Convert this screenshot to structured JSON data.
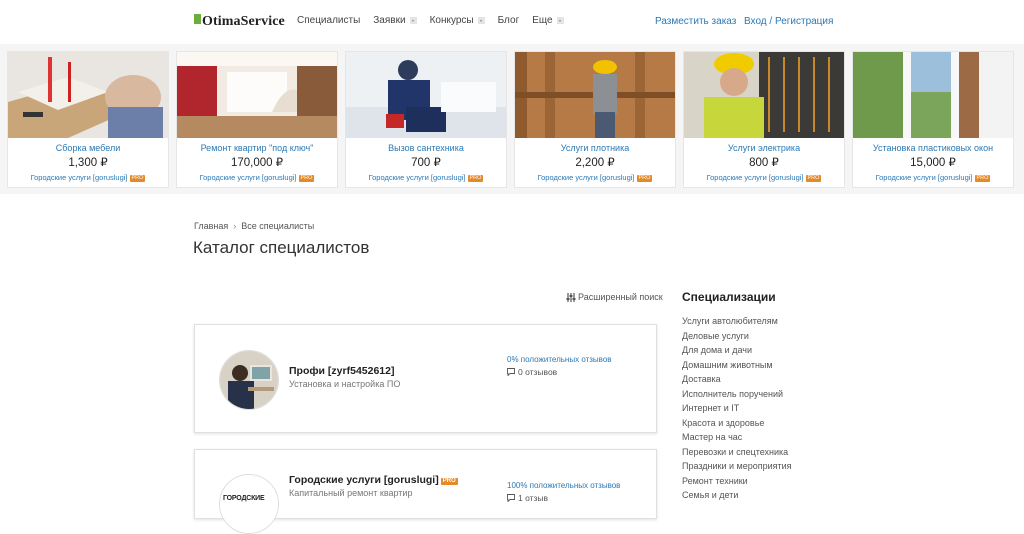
{
  "header": {
    "logo_text": "OtimaService",
    "nav": [
      {
        "label": "Специалисты",
        "dropdown": false
      },
      {
        "label": "Заявки",
        "dropdown": true
      },
      {
        "label": "Конкурсы",
        "dropdown": true
      },
      {
        "label": "Блог",
        "dropdown": false
      },
      {
        "label": "Еще",
        "dropdown": true
      }
    ],
    "post_order": "Разместить заказ",
    "login": "Вход / Регистрация"
  },
  "carousel": [
    {
      "title": "Сборка мебели",
      "price": "1,300 ₽",
      "provider": "Городские услуги [goruslugi]",
      "badge": "PRO"
    },
    {
      "title": "Ремонт квартир \"под ключ\"",
      "price": "170,000 ₽",
      "provider": "Городские услуги [goruslugi]",
      "badge": "PRO"
    },
    {
      "title": "Вызов сантехника",
      "price": "700 ₽",
      "provider": "Городские услуги [goruslugi]",
      "badge": "PRO"
    },
    {
      "title": "Услуги плотника",
      "price": "2,200 ₽",
      "provider": "Городские услуги [goruslugi]",
      "badge": "PRO"
    },
    {
      "title": "Услуги электрика",
      "price": "800 ₽",
      "provider": "Городские услуги [goruslugi]",
      "badge": "PRO"
    },
    {
      "title": "Установка пластиковых окон",
      "price": "15,000 ₽",
      "provider": "Городские услуги [goruslugi]",
      "badge": "PRO"
    }
  ],
  "breadcrumb": {
    "home": "Главная",
    "sep": "›",
    "current": "Все специалисты"
  },
  "page_title": "Каталог специалистов",
  "advanced_search": "Расширенный поиск",
  "specialists": [
    {
      "name": "Профи [zyrf5452612]",
      "subtitle": "Установка и настройка ПО",
      "rating": "0% положительных отзывов",
      "reviews": "0 отзывов",
      "badge": ""
    },
    {
      "name": "Городские услуги [goruslugi]",
      "subtitle": "Капитальный ремонт квартир",
      "rating": "100% положительных отзывов",
      "reviews": "1 отзыв",
      "badge": "PRO",
      "avatar_text": "ГОРОДСКИЕ"
    }
  ],
  "sidebar": {
    "title": "Специализации",
    "items": [
      "Услуги автолюбителям",
      "Деловые услуги",
      "Для дома и дачи",
      "Домашним животным",
      "Доставка",
      "Исполнитель поручений",
      "Интернет и IT",
      "Красота и здоровье",
      "Мастер на час",
      "Перевозки и спецтехника",
      "Праздники и мероприятия",
      "Ремонт техники",
      "Семья и дети"
    ]
  },
  "colors": {
    "link": "#2b79b5",
    "brand_green": "#6cae3b",
    "pro_badge": "#e58a2a"
  }
}
